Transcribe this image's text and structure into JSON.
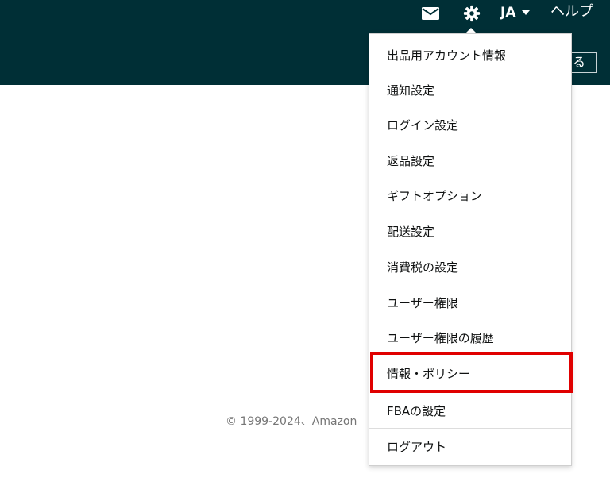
{
  "header": {
    "language": "JA",
    "help_label": "ヘルプ",
    "subbar_button_label": "る",
    "icons": [
      "mail-icon",
      "gear-icon",
      "chevron-down-icon"
    ]
  },
  "settings_menu": {
    "items": [
      "出品用アカウント情報",
      "通知設定",
      "ログイン設定",
      "返品設定",
      "ギフトオプション",
      "配送設定",
      "消費税の設定",
      "ユーザー権限",
      "ユーザー権限の履歴",
      "情報・ポリシー",
      "FBAの設定",
      "ログアウト"
    ],
    "highlighted_item": "情報・ポリシー",
    "highlight_color": "#e00000"
  },
  "footer": {
    "copyright": "© 1999-2024、Amazon"
  },
  "colors": {
    "header_background": "#002f36"
  }
}
